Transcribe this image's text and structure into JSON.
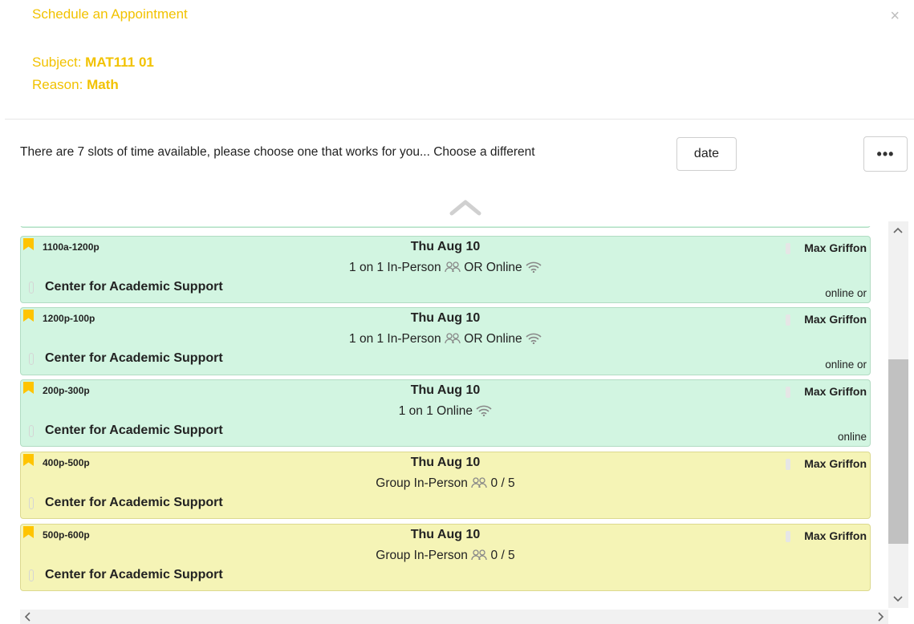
{
  "header": {
    "title": "Schedule an Appointment",
    "close_label": "×",
    "subject_label": "Subject:",
    "subject_value": "MAT111 01",
    "reason_label": "Reason:",
    "reason_value": "Math"
  },
  "toolbar": {
    "info_text": "There are 7 slots of time available, please choose one that works for you...  Choose a different",
    "date_button": "date",
    "more_button": "•••"
  },
  "colors": {
    "accent": "#f2c200",
    "slot_green": "#d2f5e1",
    "slot_yellow": "#f5f4b6",
    "bookmark": "#ffc400"
  },
  "slots": [
    {
      "time": "1100a-1200p",
      "day": "Thu Aug 10",
      "type": "1 on 1 In-Person",
      "or_text": " OR Online",
      "icons": [
        "group-icon",
        "wifi-icon"
      ],
      "staff": "Max Griffon",
      "location": "Center for Academic Support",
      "mode": "online or",
      "color": "green"
    },
    {
      "time": "1200p-100p",
      "day": "Thu Aug 10",
      "type": "1 on 1 In-Person",
      "or_text": " OR Online",
      "icons": [
        "group-icon",
        "wifi-icon"
      ],
      "staff": "Max Griffon",
      "location": "Center for Academic Support",
      "mode": "online or",
      "color": "green"
    },
    {
      "time": "200p-300p",
      "day": "Thu Aug 10",
      "type": "1 on 1 Online",
      "icons": [
        "wifi-icon"
      ],
      "staff": "Max Griffon",
      "location": "Center for Academic Support",
      "mode": "online",
      "color": "green"
    },
    {
      "time": "400p-500p",
      "day": "Thu Aug 10",
      "type": "Group In-Person",
      "capacity": "0 / 5",
      "icons": [
        "group-icon"
      ],
      "staff": "Max Griffon",
      "location": "Center for Academic Support",
      "color": "yellow"
    },
    {
      "time": "500p-600p",
      "day": "Thu Aug 10",
      "type": "Group In-Person",
      "capacity": "0 / 5",
      "icons": [
        "group-icon"
      ],
      "staff": "Max Griffon",
      "location": "Center for Academic Support",
      "color": "yellow"
    }
  ]
}
